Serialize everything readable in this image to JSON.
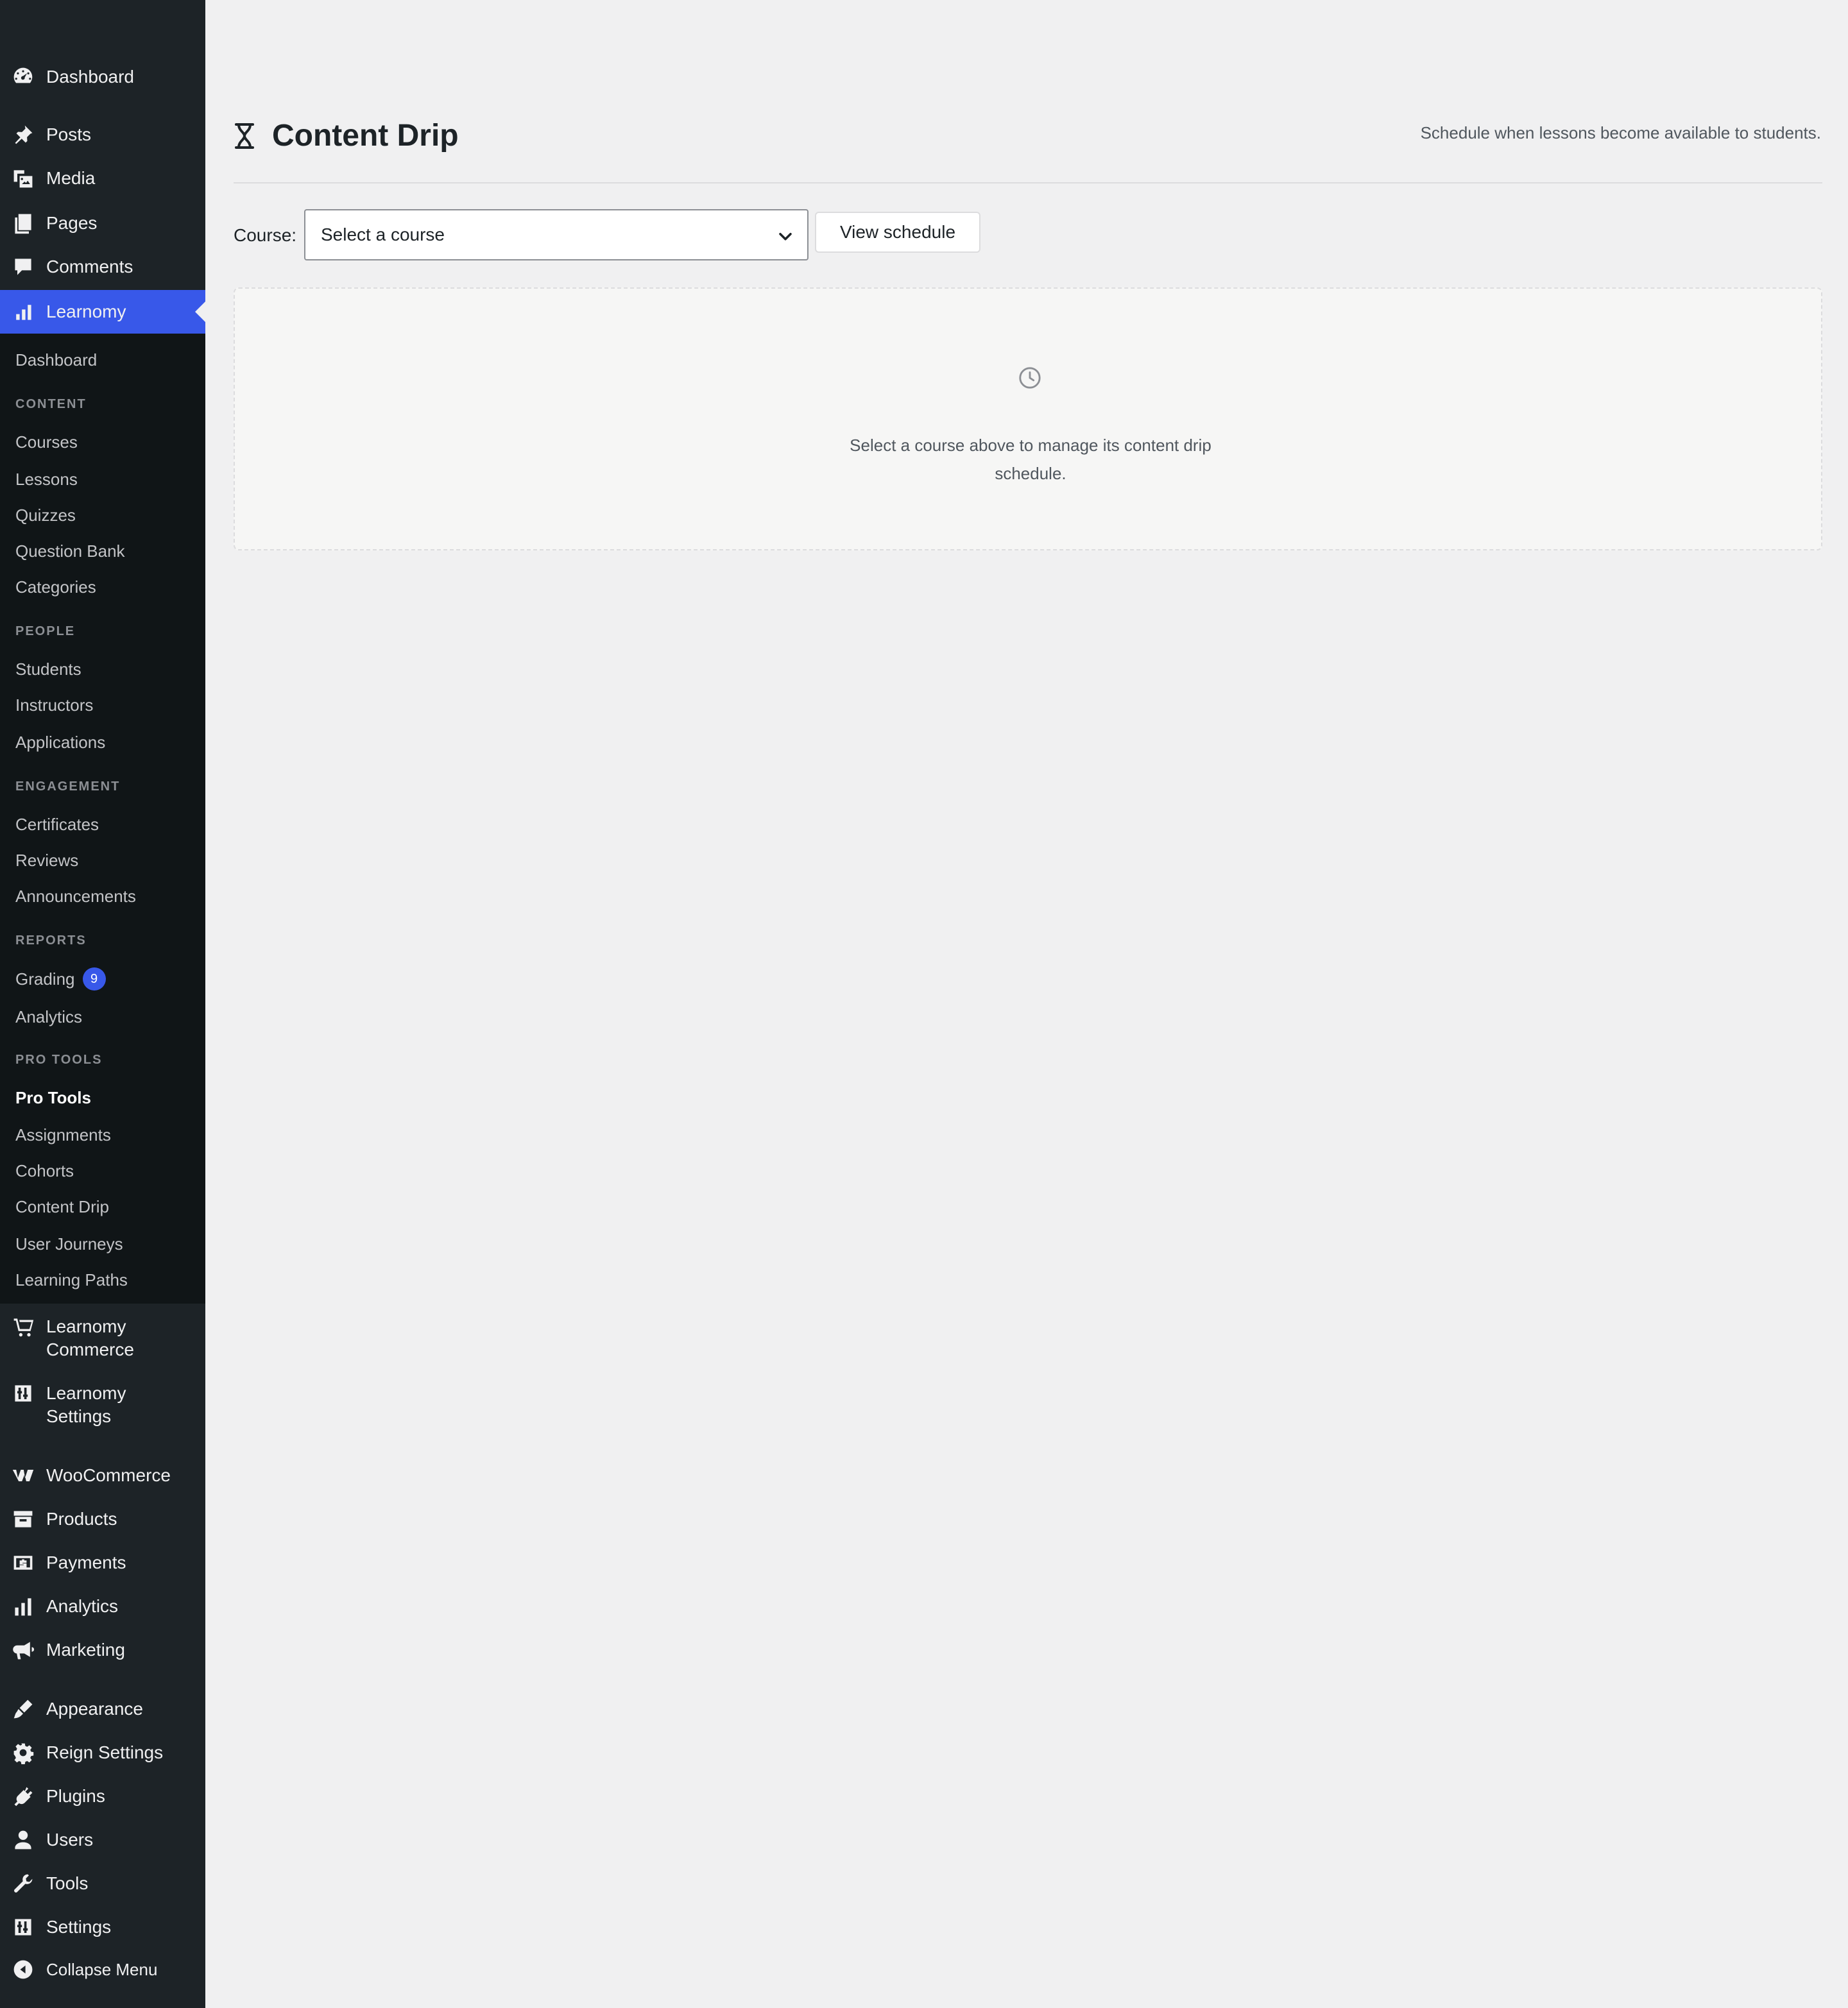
{
  "sidebar": {
    "top_items": [
      {
        "label": "Dashboard",
        "icon": "dashboard-icon"
      },
      {
        "label": "Posts",
        "icon": "pin-icon"
      },
      {
        "label": "Media",
        "icon": "media-icon"
      },
      {
        "label": "Pages",
        "icon": "pages-icon"
      },
      {
        "label": "Comments",
        "icon": "comments-icon"
      },
      {
        "label": "Learnomy",
        "icon": "bar-chart-icon"
      }
    ],
    "submenu": {
      "dashboard": "Dashboard",
      "content_heading": "CONTENT",
      "courses": "Courses",
      "lessons": "Lessons",
      "quizzes": "Quizzes",
      "question_bank": "Question Bank",
      "categories": "Categories",
      "people_heading": "PEOPLE",
      "students": "Students",
      "instructors": "Instructors",
      "applications": "Applications",
      "engagement_heading": "ENGAGEMENT",
      "certificates": "Certificates",
      "reviews": "Reviews",
      "announcements": "Announcements",
      "reports_heading": "REPORTS",
      "grading": "Grading",
      "grading_count": "9",
      "analytics": "Analytics",
      "pro_tools_heading": "PRO TOOLS",
      "pro_tools": "Pro Tools",
      "assignments": "Assignments",
      "cohorts": "Cohorts",
      "content_drip": "Content Drip",
      "user_journeys": "User Journeys",
      "learning_paths": "Learning Paths"
    },
    "bottom_items": [
      {
        "label_1": "Learnomy",
        "label_2": "Commerce",
        "icon": "cart-icon"
      },
      {
        "label_1": "Learnomy",
        "label_2": "Settings",
        "icon": "settings-sliders-icon"
      },
      {
        "label": "WooCommerce",
        "icon": "woocommerce-icon"
      },
      {
        "label": "Products",
        "icon": "archive-icon"
      },
      {
        "label": "Payments",
        "icon": "dollar-icon"
      },
      {
        "label": "Analytics",
        "icon": "bar-chart-icon"
      },
      {
        "label": "Marketing",
        "icon": "megaphone-icon"
      },
      {
        "label": "Appearance",
        "icon": "brush-icon"
      },
      {
        "label": "Reign Settings",
        "icon": "gear-icon"
      },
      {
        "label": "Plugins",
        "icon": "plug-icon"
      },
      {
        "label": "Users",
        "icon": "user-icon"
      },
      {
        "label": "Tools",
        "icon": "wrench-icon"
      },
      {
        "label": "Settings",
        "icon": "settings-sliders-icon"
      },
      {
        "label": "Collapse Menu",
        "icon": "collapse-icon"
      }
    ],
    "accent_color": "#3858e9"
  },
  "main": {
    "title": "Content Drip",
    "title_icon": "hourglass-icon",
    "description": "Schedule when lessons become available to students.",
    "course_label": "Course:",
    "course_select_value": "Select a course",
    "view_button": "View schedule",
    "empty_icon": "clock-icon",
    "empty_text": "Select a course above to manage its content drip schedule."
  }
}
